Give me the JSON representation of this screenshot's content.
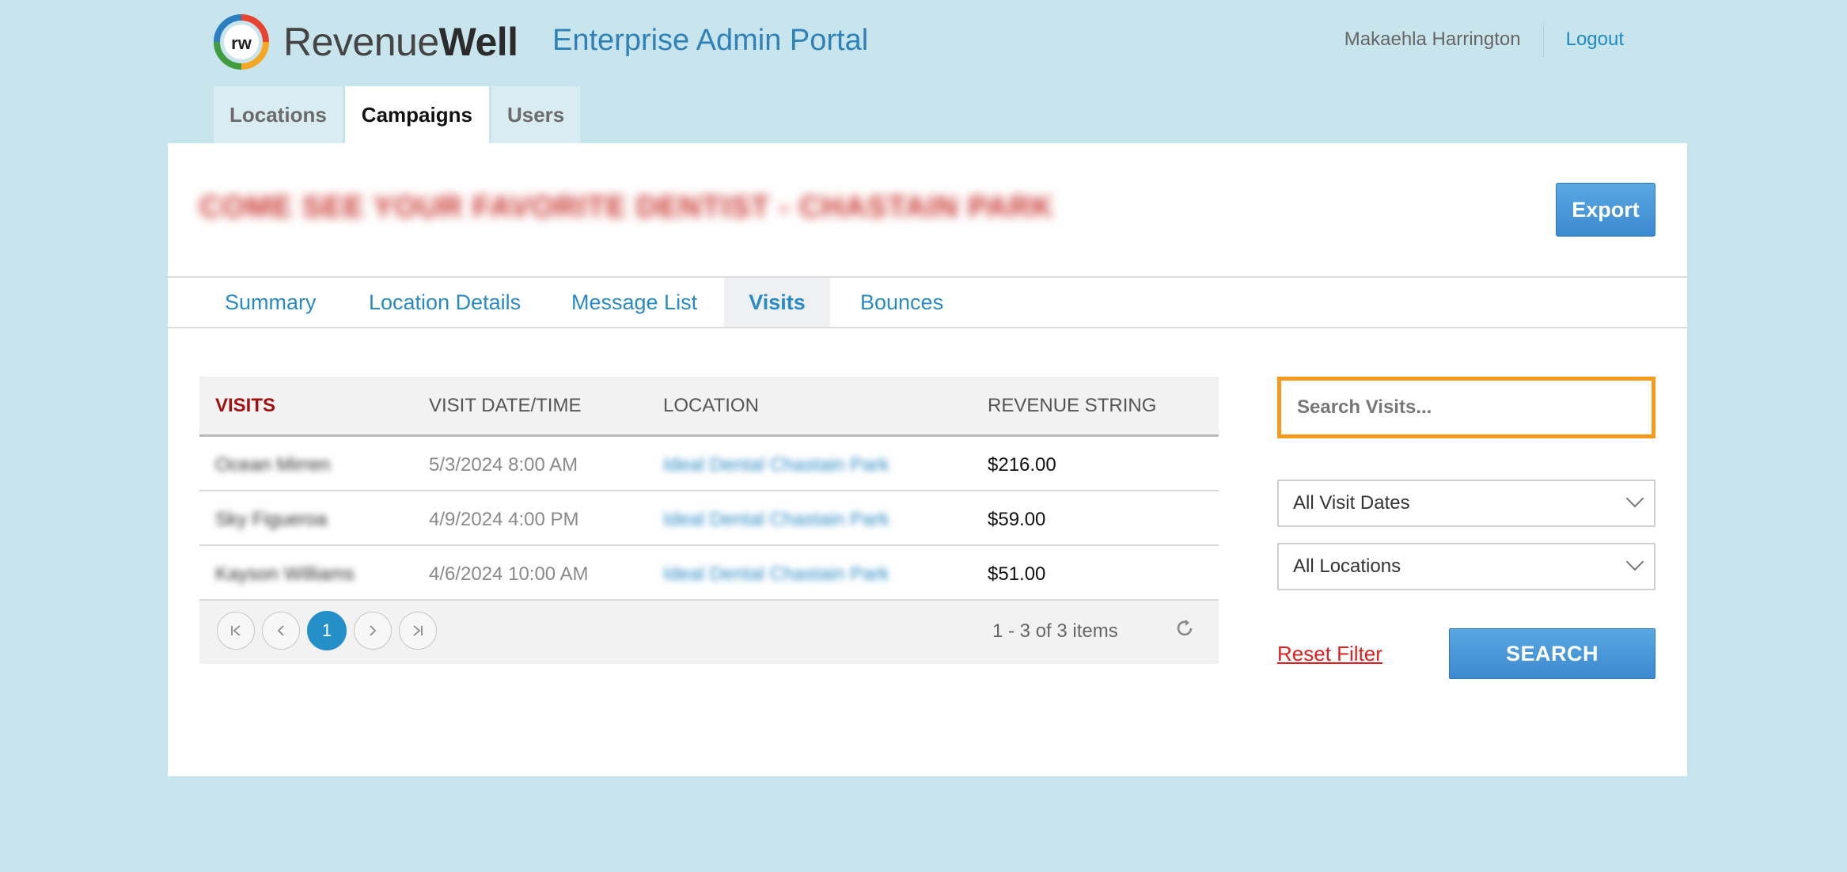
{
  "header": {
    "logo_mark": "rw",
    "logo_text_light": "Revenue",
    "logo_text_bold": "Well",
    "portal_title": "Enterprise Admin Portal",
    "user_name": "Makaehla Harrington",
    "logout_label": "Logout"
  },
  "top_tabs": [
    {
      "label": "Locations",
      "active": false
    },
    {
      "label": "Campaigns",
      "active": true
    },
    {
      "label": "Users",
      "active": false
    }
  ],
  "campaign": {
    "title": "COME SEE YOUR FAVORITE DENTIST - CHASTAIN PARK",
    "export_label": "Export"
  },
  "sub_tabs": [
    {
      "label": "Summary",
      "active": false
    },
    {
      "label": "Location Details",
      "active": false
    },
    {
      "label": "Message List",
      "active": false
    },
    {
      "label": "Visits",
      "active": true
    },
    {
      "label": "Bounces",
      "active": false
    }
  ],
  "grid": {
    "columns": [
      "VISITS",
      "VISIT DATE/TIME",
      "LOCATION",
      "REVENUE STRING"
    ],
    "rows": [
      {
        "name": "Ocean Mirren",
        "date": "5/3/2024 8:00 AM",
        "location": "Ideal Dental Chastain Park",
        "revenue": "$216.00"
      },
      {
        "name": "Sky Figueroa",
        "date": "4/9/2024 4:00 PM",
        "location": "Ideal Dental Chastain Park",
        "revenue": "$59.00"
      },
      {
        "name": "Kayson Williams",
        "date": "4/6/2024 10:00 AM",
        "location": "Ideal Dental Chastain Park",
        "revenue": "$51.00"
      }
    ],
    "pager": {
      "current_page": "1",
      "info": "1 - 3 of 3 items"
    }
  },
  "filters": {
    "search_placeholder": "Search Visits...",
    "visit_dates_selected": "All Visit Dates",
    "locations_selected": "All Locations",
    "reset_label": "Reset Filter",
    "search_label": "SEARCH"
  },
  "icons": {
    "first_page": "first-page-icon",
    "prev_page": "prev-page-icon",
    "next_page": "next-page-icon",
    "last_page": "last-page-icon",
    "refresh": "refresh-icon",
    "dropdown": "chevron-down-icon"
  },
  "colors": {
    "page_bg": "#c8e4ec",
    "accent_blue": "#2a8ac4",
    "button_blue": "#3c8ad0",
    "search_outline": "#f39a1f",
    "reset_red": "#e02020",
    "visits_header_red": "#a01212"
  }
}
